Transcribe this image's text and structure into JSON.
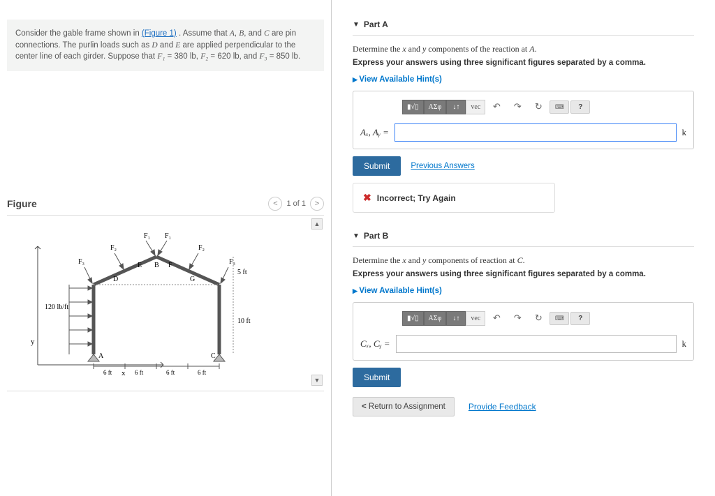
{
  "problem": {
    "text_prefix": "Consider the gable frame shown in ",
    "figure_link": "(Figure 1)",
    "text_mid": ". Assume that ",
    "pinA": "A",
    "pinB": "B",
    "pinC": "C",
    "text_pins": " are pin connections. The purlin loads such as ",
    "purlinD": "D",
    "purlinE": "E",
    "text_loads": " are applied perpendicular to the center line of each girder. Suppose that ",
    "f1_label": "F₁",
    "f1_val": "= 380 lb",
    "f2_label": "F₂",
    "f2_val": "= 620 lb",
    "f3_label": "F₃",
    "f3_val": "= 850 lb",
    "and": ", and ",
    "comma": ", "
  },
  "figure": {
    "title": "Figure",
    "nav_prev": "<",
    "nav_label": "1 of 1",
    "nav_next": ">",
    "labels": {
      "wind": "120 lb/ft",
      "y": "y",
      "x": "x",
      "A": "A",
      "B": "B",
      "C": "C",
      "D": "D",
      "E": "E",
      "F": "F",
      "G": "G",
      "F1a": "F₁",
      "F1b": "F₁",
      "F2a": "F₂",
      "F2b": "F₂",
      "F3a": "F₃",
      "F3b": "F₃",
      "h10": "10 ft",
      "h5": "5 ft",
      "d6a": "6 ft",
      "d6b": "6 ft",
      "d6c": "6 ft",
      "d6d": "6 ft"
    }
  },
  "partA": {
    "title": "Part A",
    "question_prefix": "Determine the ",
    "var_x": "x",
    "q_and": " and ",
    "var_y": "y",
    "question_suffix": " components of the reaction at ",
    "point": "A",
    "period": ".",
    "instruction": "Express your answers using three significant figures separated by a comma.",
    "hints": "View Available Hint(s)",
    "input_label": "Aₓ, Aᵧ =",
    "unit": "k",
    "submit": "Submit",
    "prev_answers": "Previous Answers",
    "feedback": "Incorrect; Try Again",
    "input_value": ""
  },
  "partB": {
    "title": "Part B",
    "question_prefix": "Determine the ",
    "var_x": "x",
    "q_and": " and ",
    "var_y": "y",
    "question_suffix": " components of reaction at ",
    "point": "C",
    "period": ".",
    "instruction": "Express your answers using three significant figures separated by a comma.",
    "hints": "View Available Hint(s)",
    "input_label": "Cₓ, Cᵧ =",
    "unit": "k",
    "submit": "Submit",
    "input_value": ""
  },
  "toolbar": {
    "templates": "▮√▯",
    "greek": "ΑΣφ",
    "scripts": "↓↑",
    "vec": "vec",
    "undo": "↶",
    "redo": "↷",
    "reset": "↻",
    "keyboard": "⌨",
    "help": "?"
  },
  "footer": {
    "return_label": "Return to Assignment",
    "feedback_label": "Provide Feedback"
  }
}
